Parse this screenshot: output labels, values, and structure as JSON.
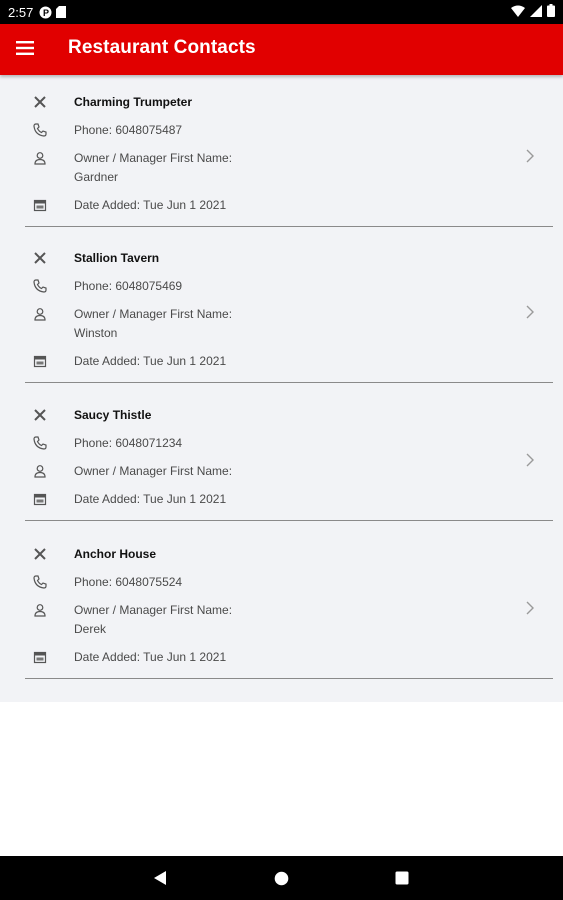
{
  "status_bar": {
    "time": "2:57"
  },
  "app_bar": {
    "title": "Restaurant Contacts"
  },
  "labels": {
    "phone_prefix": "Phone: ",
    "owner_label": "Owner / Manager First Name:",
    "date_prefix": "Date Added: "
  },
  "contacts": [
    {
      "name": "Charming Trumpeter",
      "phone": "Phone: 6048075487",
      "owner_label": "Owner / Manager First Name:",
      "owner": "Gardner",
      "date": "Date Added: Tue Jun 1 2021"
    },
    {
      "name": "Stallion Tavern",
      "phone": "Phone: 6048075469",
      "owner_label": "Owner / Manager First Name:",
      "owner": "Winston",
      "date": "Date Added: Tue Jun 1 2021"
    },
    {
      "name": "Saucy Thistle",
      "phone": "Phone: 6048071234",
      "owner_label": "Owner / Manager First Name:",
      "owner": "",
      "date": "Date Added: Tue Jun 1 2021"
    },
    {
      "name": "Anchor House",
      "phone": "Phone: 6048075524",
      "owner_label": "Owner / Manager First Name:",
      "owner": "Derek",
      "date": "Date Added: Tue Jun 1 2021"
    }
  ],
  "colors": {
    "app_bar": "#e10000",
    "background": "#f2f3f6",
    "status_bar": "#000000"
  },
  "icons": {
    "row_name": "cutlery-icon",
    "row_phone": "phone-icon",
    "row_owner": "person-icon",
    "row_date": "calendar-icon",
    "row_action": "chevron-right-icon"
  }
}
